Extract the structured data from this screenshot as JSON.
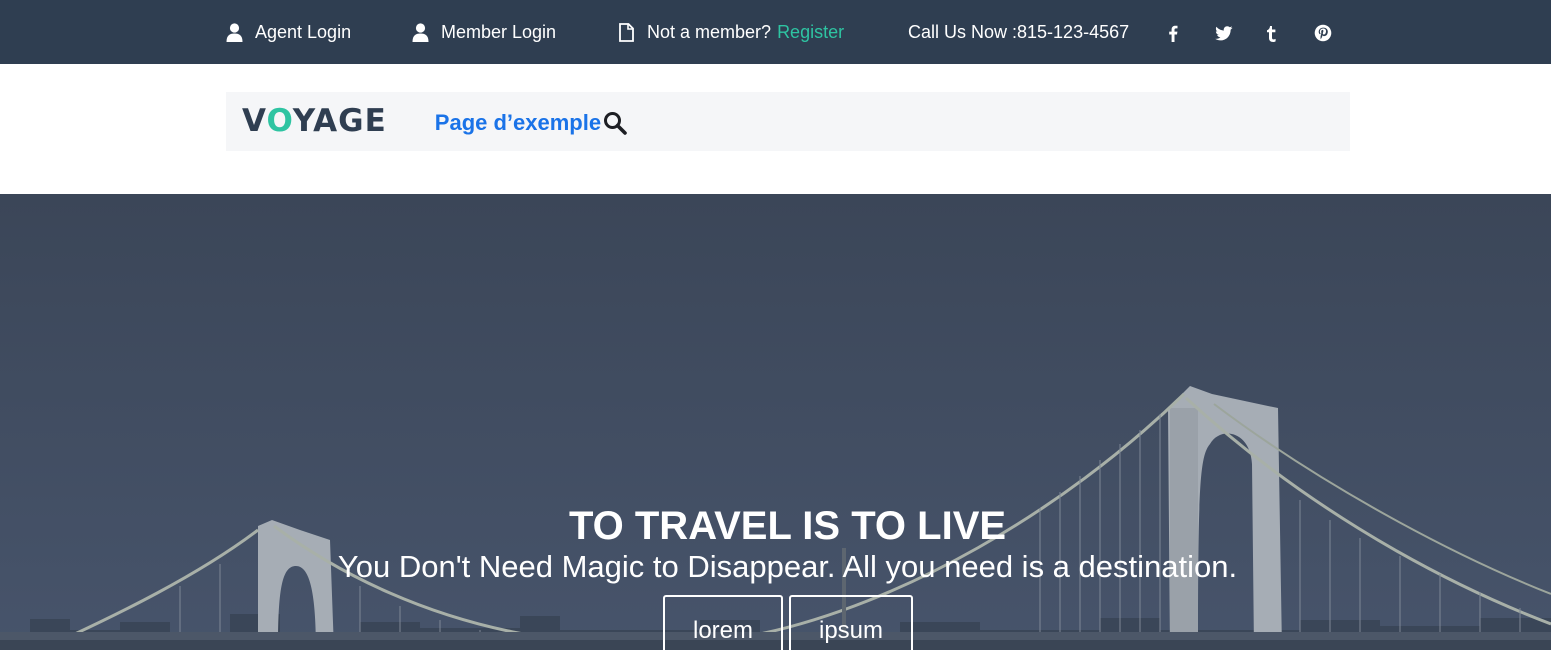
{
  "topbar": {
    "agent_login": "Agent Login",
    "member_login": "Member Login",
    "not_member": "Not a member?",
    "register": "Register",
    "call_us": "Call Us Now :815-123-4567",
    "social": [
      "facebook-icon",
      "twitter-icon",
      "tumblr-icon",
      "pinterest-icon"
    ]
  },
  "header": {
    "logo_part1": "V",
    "logo_accent": "O",
    "logo_part2": "YAGE",
    "nav_link": "Page d’exemple"
  },
  "hero": {
    "title": "TO TRAVEL IS TO LIVE",
    "subtitle": "You Don't Need Magic to Disappear. All you need is a destination.",
    "buttons": [
      "lorem",
      "ipsum"
    ]
  },
  "colors": {
    "topbar_bg": "#2f3e51",
    "accent": "#2ec4a2",
    "nav_link": "#1a73e8",
    "hero_overlay": "#3f4b5d"
  }
}
